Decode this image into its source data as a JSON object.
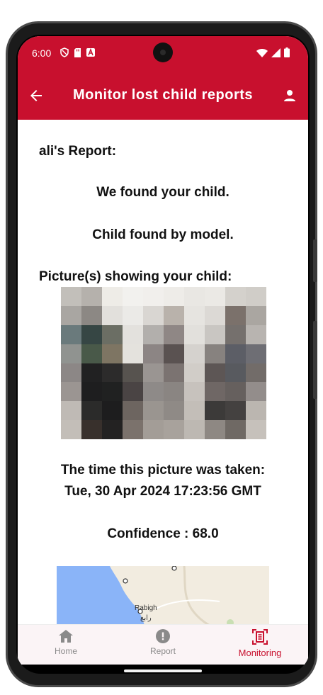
{
  "status_bar": {
    "time": "6:00",
    "left_icons": [
      "shield-icon",
      "sd-card-icon",
      "accessibility-a-icon"
    ],
    "right_icons": [
      "wifi-icon",
      "signal-icon",
      "battery-icon"
    ]
  },
  "app_bar": {
    "title": "Monitor lost child reports",
    "back_icon": "arrow-back-icon",
    "profile_icon": "person-icon",
    "color": "#c8102e"
  },
  "report": {
    "title": "ali's Report:",
    "found_message": "We found your child.",
    "found_by": "Child found by model.",
    "pictures_label": "Picture(s) showing your child:",
    "time_label": "The time this picture was taken:",
    "time_value": "Tue, 30 Apr 2024 17:23:56 GMT",
    "confidence": "Confidence : 68.0"
  },
  "map": {
    "place_labels": [
      "Rabigh",
      "رابغ"
    ]
  },
  "bottom_nav": {
    "items": [
      {
        "label": "Home",
        "icon": "home-icon",
        "active": false
      },
      {
        "label": "Report",
        "icon": "alert-circle-icon",
        "active": false
      },
      {
        "label": "Monitoring",
        "icon": "document-scanner-icon",
        "active": true
      }
    ]
  }
}
